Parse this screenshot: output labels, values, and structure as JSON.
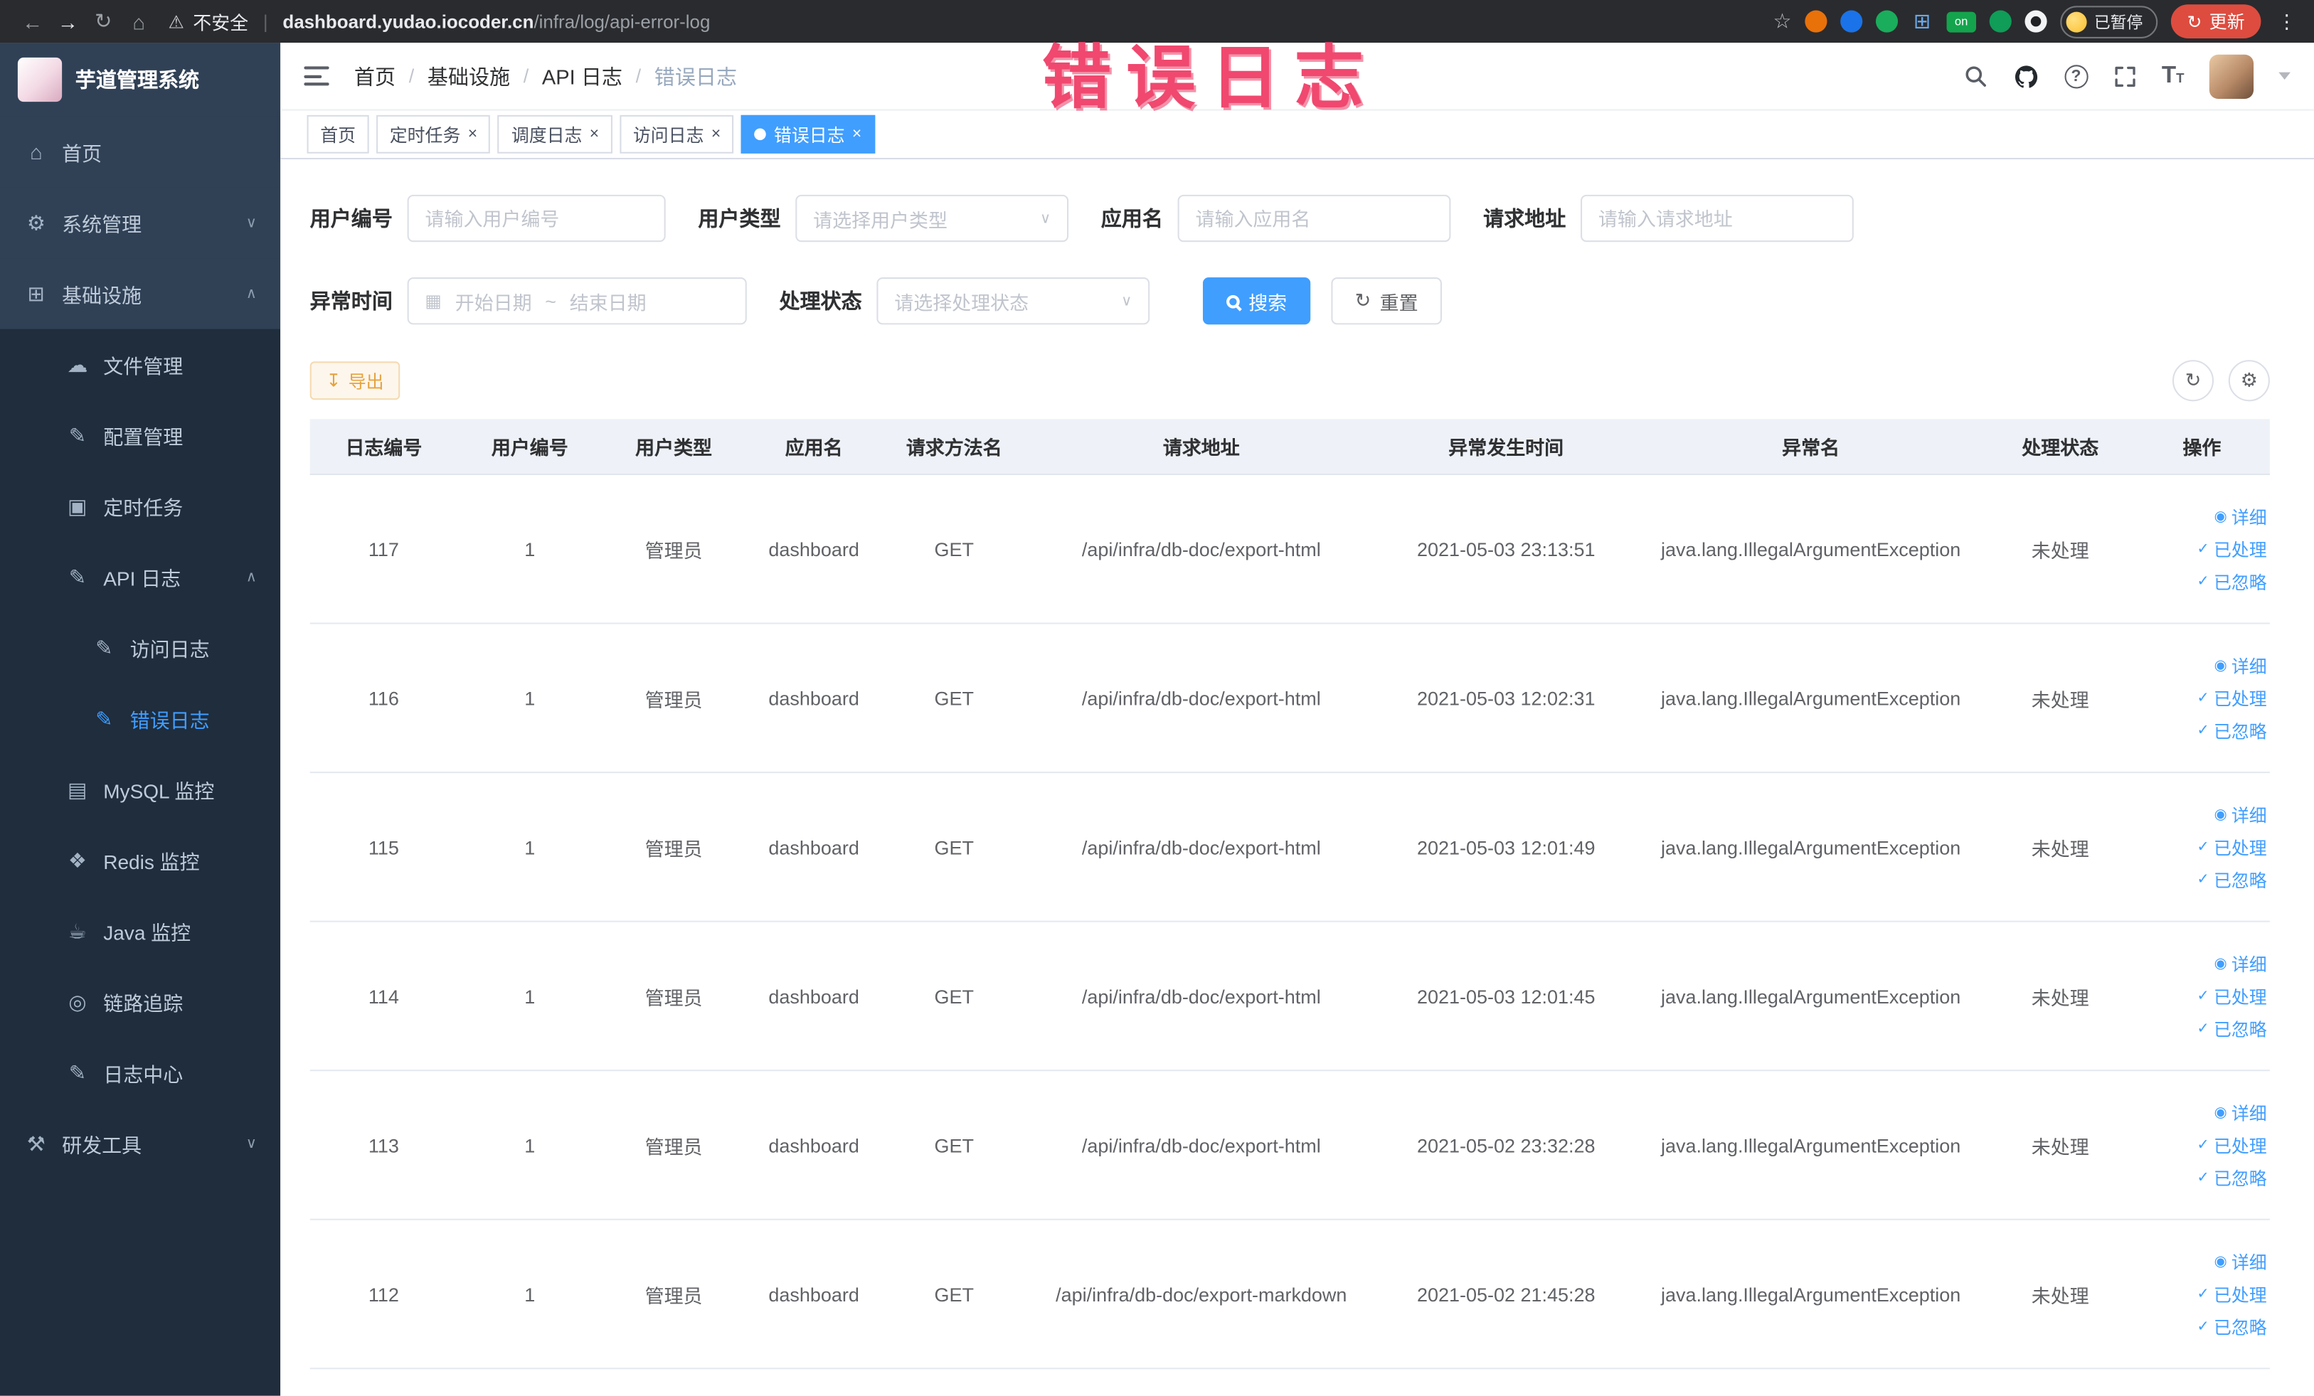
{
  "annotation": {
    "text": "错误日志"
  },
  "browser": {
    "security_label": "不安全",
    "url_domain": "dashboard.yudao.iocoder.cn",
    "url_path": "/infra/log/api-error-log",
    "paused_badge": "已暂停",
    "update_button": "更新",
    "extension_on_badge": "on"
  },
  "icons": {
    "back": "←",
    "forward": "→",
    "reload": "↻",
    "home": "⌂",
    "warning": "⚠",
    "star": "☆",
    "kebab": "⋮",
    "close": "×",
    "chev_down": "∨",
    "chev_up": "∧",
    "calendar": "▦",
    "select_arrow": "∨",
    "refresh": "↻",
    "gear": "⚙",
    "download": "↧",
    "eye": "◉",
    "check": "✓",
    "question": "?",
    "font_size": "T",
    "menu_home": "⌂",
    "menu_system": "⚙",
    "menu_infra": "⊞",
    "menu_file": "☁",
    "menu_config": "✎",
    "menu_job": "▣",
    "menu_api_log": "✎",
    "menu_access_log": "✎",
    "menu_error_log": "✎",
    "menu_mysql": "▤",
    "menu_redis": "❖",
    "menu_java": "☕",
    "menu_trace": "◎",
    "menu_log_center": "✎",
    "menu_dev_tools": "⚒"
  },
  "sidebar": {
    "logo_title": "芋道管理系统",
    "items": [
      {
        "label": "首页"
      },
      {
        "label": "系统管理"
      },
      {
        "label": "基础设施"
      },
      {
        "label": "文件管理"
      },
      {
        "label": "配置管理"
      },
      {
        "label": "定时任务"
      },
      {
        "label": "API 日志"
      },
      {
        "label": "访问日志"
      },
      {
        "label": "错误日志"
      },
      {
        "label": "MySQL 监控"
      },
      {
        "label": "Redis 监控"
      },
      {
        "label": "Java 监控"
      },
      {
        "label": "链路追踪"
      },
      {
        "label": "日志中心"
      },
      {
        "label": "研发工具"
      }
    ]
  },
  "header": {
    "breadcrumb": [
      {
        "label": "首页"
      },
      {
        "label": "基础设施"
      },
      {
        "label": "API 日志"
      },
      {
        "label": "错误日志"
      }
    ]
  },
  "tabs": [
    {
      "label": "首页"
    },
    {
      "label": "定时任务"
    },
    {
      "label": "调度日志"
    },
    {
      "label": "访问日志"
    },
    {
      "label": "错误日志"
    }
  ],
  "filters": {
    "user_id_label": "用户编号",
    "user_id_placeholder": "请输入用户编号",
    "user_type_label": "用户类型",
    "user_type_placeholder": "请选择用户类型",
    "app_name_label": "应用名",
    "app_name_placeholder": "请输入应用名",
    "request_url_label": "请求地址",
    "request_url_placeholder": "请输入请求地址",
    "exception_time_label": "异常时间",
    "date_start_placeholder": "开始日期",
    "date_separator": "~",
    "date_end_placeholder": "结束日期",
    "process_status_label": "处理状态",
    "process_status_placeholder": "请选择处理状态",
    "search_button": "搜索",
    "reset_button": "重置"
  },
  "toolbar": {
    "export_button": "导出"
  },
  "table": {
    "headers": [
      "日志编号",
      "用户编号",
      "用户类型",
      "应用名",
      "请求方法名",
      "请求地址",
      "异常发生时间",
      "异常名",
      "处理状态",
      "操作"
    ],
    "action_detail": "详细",
    "action_processed": "已处理",
    "action_ignored": "已忽略",
    "rows": [
      {
        "id": "117",
        "user_id": "1",
        "user_type": "管理员",
        "app": "dashboard",
        "method": "GET",
        "url": "/api/infra/db-doc/export-html",
        "time": "2021-05-03 23:13:51",
        "exception": "java.lang.IllegalArgumentException",
        "status": "未处理"
      },
      {
        "id": "116",
        "user_id": "1",
        "user_type": "管理员",
        "app": "dashboard",
        "method": "GET",
        "url": "/api/infra/db-doc/export-html",
        "time": "2021-05-03 12:02:31",
        "exception": "java.lang.IllegalArgumentException",
        "status": "未处理"
      },
      {
        "id": "115",
        "user_id": "1",
        "user_type": "管理员",
        "app": "dashboard",
        "method": "GET",
        "url": "/api/infra/db-doc/export-html",
        "time": "2021-05-03 12:01:49",
        "exception": "java.lang.IllegalArgumentException",
        "status": "未处理"
      },
      {
        "id": "114",
        "user_id": "1",
        "user_type": "管理员",
        "app": "dashboard",
        "method": "GET",
        "url": "/api/infra/db-doc/export-html",
        "time": "2021-05-03 12:01:45",
        "exception": "java.lang.IllegalArgumentException",
        "status": "未处理"
      },
      {
        "id": "113",
        "user_id": "1",
        "user_type": "管理员",
        "app": "dashboard",
        "method": "GET",
        "url": "/api/infra/db-doc/export-html",
        "time": "2021-05-02 23:32:28",
        "exception": "java.lang.IllegalArgumentException",
        "status": "未处理"
      },
      {
        "id": "112",
        "user_id": "1",
        "user_type": "管理员",
        "app": "dashboard",
        "method": "GET",
        "url": "/api/infra/db-doc/export-markdown",
        "time": "2021-05-02 21:45:28",
        "exception": "java.lang.IllegalArgumentException",
        "status": "未处理"
      }
    ]
  }
}
